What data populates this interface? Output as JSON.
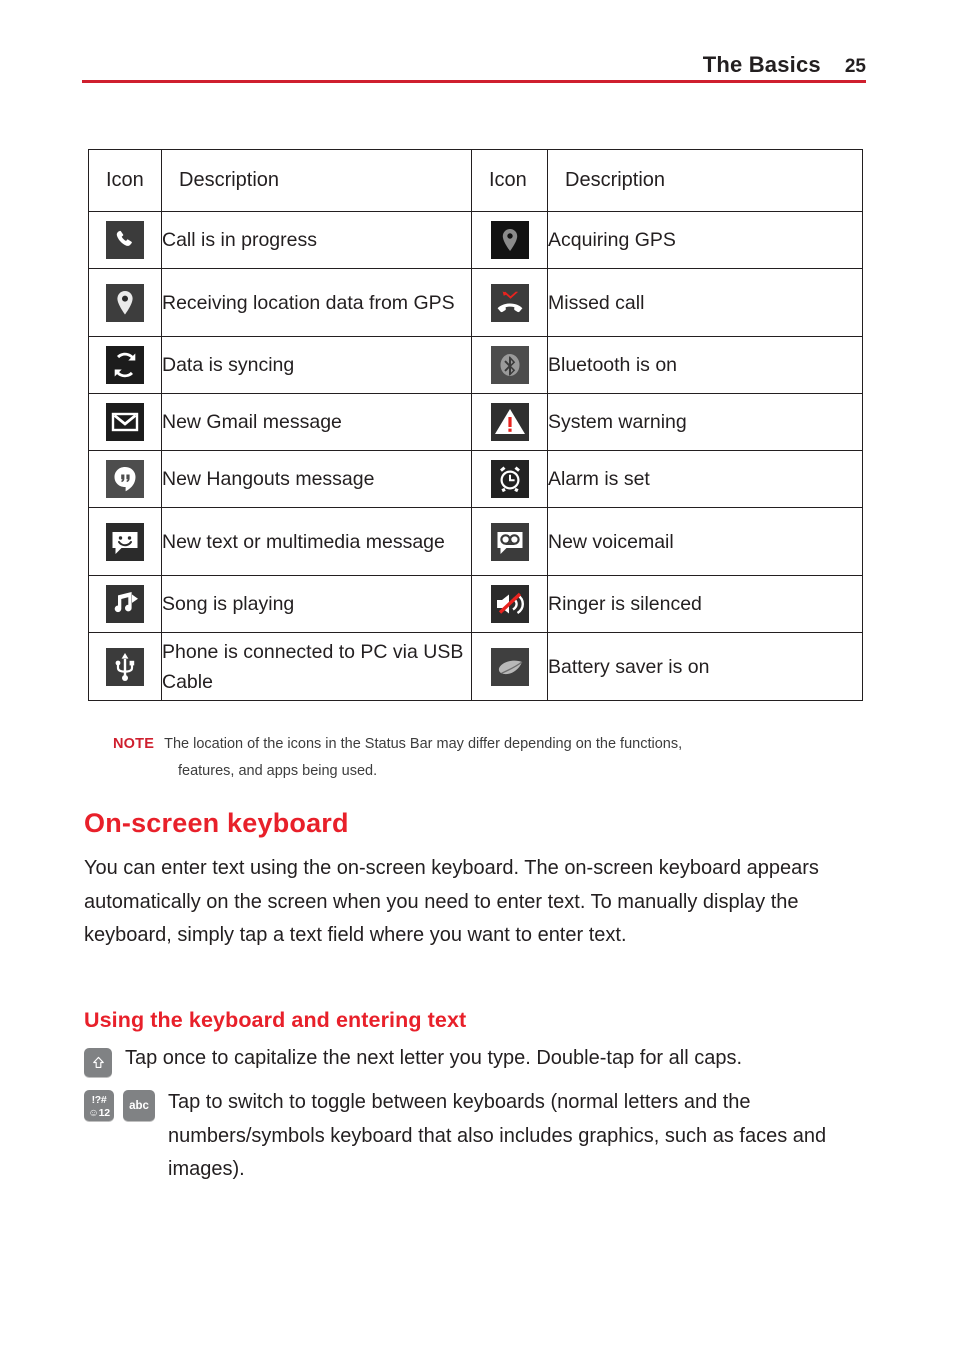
{
  "header": {
    "title": "The Basics",
    "page_number": "25",
    "rule_color": "#cf1f2e"
  },
  "icon_table": {
    "headers": [
      "Icon",
      "Description",
      "Icon",
      "Description"
    ],
    "rows": [
      {
        "left": {
          "icon": "phone-call-icon",
          "desc": "Call is in progress"
        },
        "right": {
          "icon": "gps-acquiring-icon",
          "desc": "Acquiring GPS"
        }
      },
      {
        "left": {
          "icon": "gps-location-icon",
          "desc": "Receiving location data from GPS"
        },
        "right": {
          "icon": "missed-call-icon",
          "desc": "Missed call"
        }
      },
      {
        "left": {
          "icon": "sync-icon",
          "desc": "Data is syncing"
        },
        "right": {
          "icon": "bluetooth-icon",
          "desc": "Bluetooth is on"
        }
      },
      {
        "left": {
          "icon": "gmail-icon",
          "desc": "New Gmail message"
        },
        "right": {
          "icon": "warning-triangle-icon",
          "desc": "System warning"
        }
      },
      {
        "left": {
          "icon": "hangouts-icon",
          "desc": "New Hangouts message"
        },
        "right": {
          "icon": "alarm-clock-icon",
          "desc": "Alarm is set"
        }
      },
      {
        "left": {
          "icon": "sms-message-icon",
          "desc": "New text or multimedia message"
        },
        "right": {
          "icon": "voicemail-icon",
          "desc": "New voicemail"
        }
      },
      {
        "left": {
          "icon": "music-note-icon",
          "desc": "Song is playing"
        },
        "right": {
          "icon": "ringer-silenced-icon",
          "desc": "Ringer is silenced"
        }
      },
      {
        "left": {
          "icon": "usb-icon",
          "desc": "Phone is connected to PC via USB Cable"
        },
        "right": {
          "icon": "battery-saver-leaf-icon",
          "desc": "Battery saver is on"
        }
      }
    ]
  },
  "note": {
    "label": "NOTE",
    "line1": "The location of the icons in the Status Bar may differ depending on the functions,",
    "line2": "features, and apps being used.",
    "label_color": "#cf1f2e"
  },
  "section": {
    "heading": "On-screen keyboard",
    "heading_color": "#e8202a",
    "paragraph": "You can enter text using the on-screen keyboard. The on-screen keyboard appears automatically on the screen when you need to enter text. To manually display the keyboard, simply tap a text field where you want to enter text."
  },
  "subsection": {
    "heading": "Using the keyboard and entering text",
    "heading_color": "#e8202a",
    "items": [
      {
        "keys": [
          "shift-key"
        ],
        "text": "Tap once to capitalize the next letter you type. Double-tap for all caps."
      },
      {
        "keys": [
          "symbols-key",
          "abc-key"
        ],
        "symbols_key_top": "!?#",
        "symbols_key_bottom": "12",
        "abc_key_label": "abc",
        "text": "Tap to switch to toggle between keyboards (normal letters and the numbers/symbols keyboard that also includes graphics, such as faces and images)."
      }
    ]
  }
}
